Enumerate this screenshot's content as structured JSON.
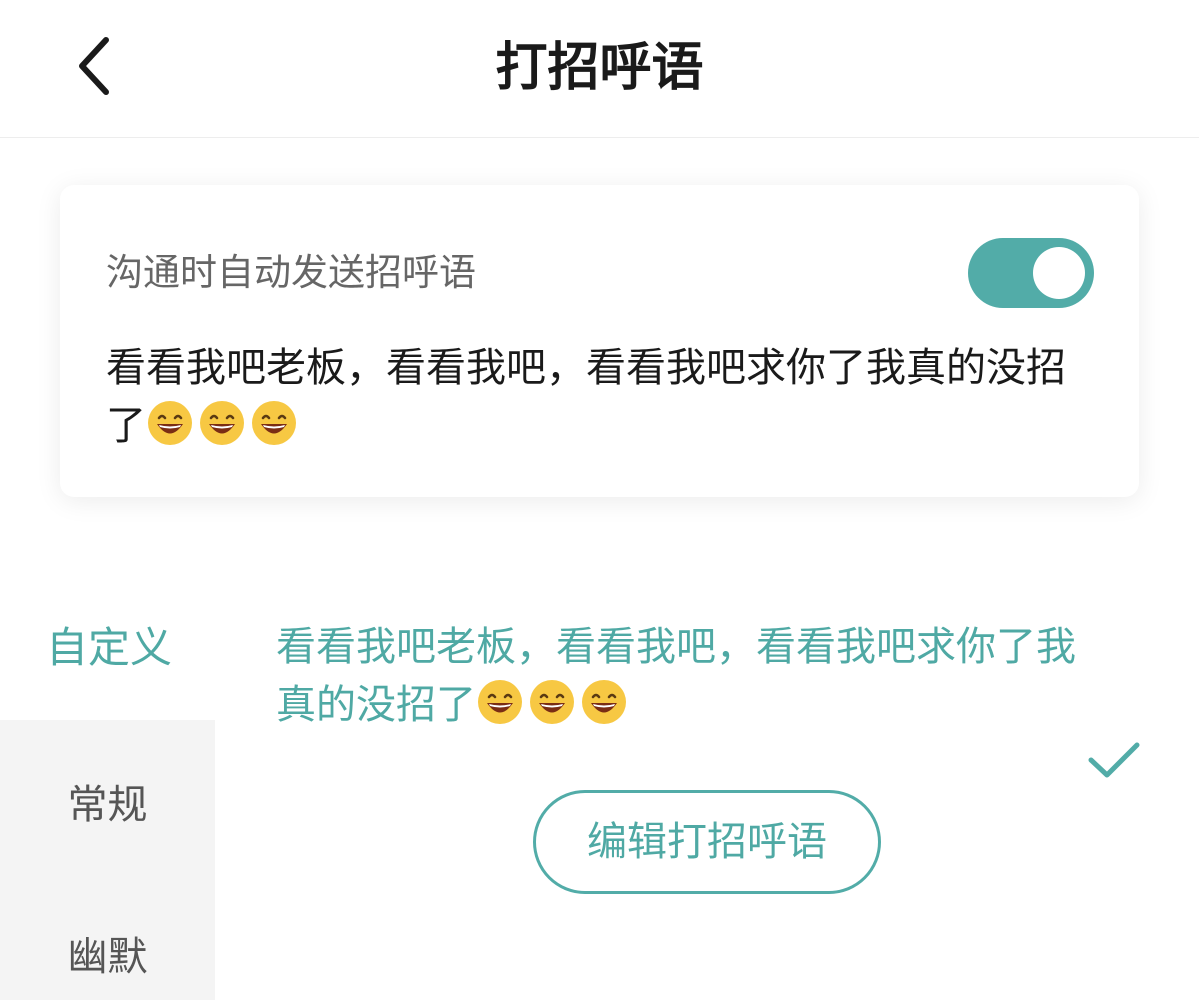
{
  "header": {
    "title": "打招呼语",
    "back_icon": "chevron-left-icon"
  },
  "card": {
    "auto_send_label": "沟通时自动发送招呼语",
    "auto_send_enabled": true,
    "message": "看看我吧老板，看看我吧，看看我吧求你了我真的没招了",
    "emoji_icons": [
      "grinning-face-icon",
      "grinning-face-icon",
      "grinning-face-icon"
    ]
  },
  "categories": {
    "active": "自定义",
    "items": [
      "常规",
      "幽默"
    ]
  },
  "options": [
    {
      "text": "看看我吧老板，看看我吧，看看我吧求你了我真的没招了",
      "selected": true
    }
  ],
  "actions": {
    "edit_label": "编辑打招呼语"
  },
  "colors": {
    "accent": "#52aca8",
    "accent_text": "#4fa9a4",
    "sidebar_bg": "#f4f4f4"
  }
}
